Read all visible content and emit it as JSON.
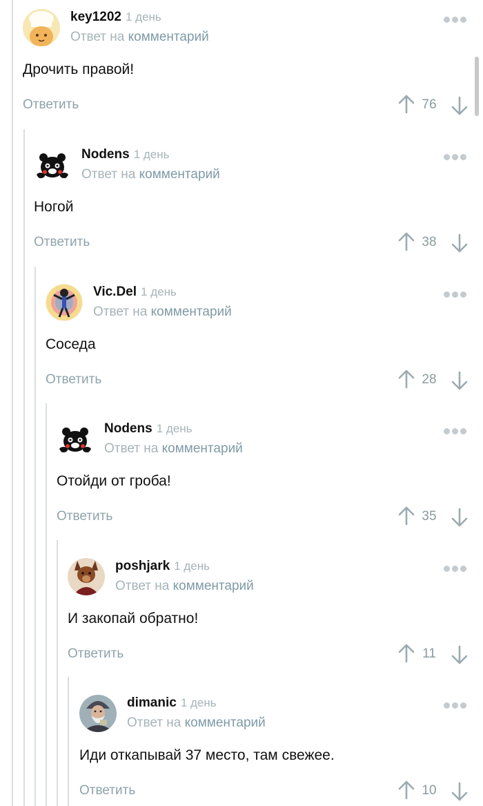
{
  "comments": [
    {
      "author": "key1202",
      "time": "1 день",
      "reply_prefix": "Ответ на",
      "reply_link": "комментарий",
      "text": "Дрочить правой!",
      "reply_label": "Ответить",
      "rating": "76",
      "avatar": "chef-cat-avatar"
    },
    {
      "author": "Nodens",
      "time": "1 день",
      "reply_prefix": "Ответ на",
      "reply_link": "комментарий",
      "text": "Ногой",
      "reply_label": "Ответить",
      "rating": "38",
      "avatar": "kumamon-bear-avatar"
    },
    {
      "author": "Vic.Del",
      "time": "1 день",
      "reply_prefix": "Ответ на",
      "reply_link": "комментарий",
      "text": "Соседа",
      "reply_label": "Ответить",
      "rating": "28",
      "avatar": "colorful-figure-avatar"
    },
    {
      "author": "Nodens",
      "time": "1 день",
      "reply_prefix": "Ответ на",
      "reply_link": "комментарий",
      "text": "Отойди от гроба!",
      "reply_label": "Ответить",
      "rating": "35",
      "avatar": "kumamon-bear-avatar"
    },
    {
      "author": "poshjark",
      "time": "1 день",
      "reply_prefix": "Ответ на",
      "reply_link": "комментарий",
      "text": "И закопай обратно!",
      "reply_label": "Ответить",
      "rating": "11",
      "avatar": "fox-character-avatar"
    },
    {
      "author": "dimanic",
      "time": "1 день",
      "reply_prefix": "Ответ на",
      "reply_link": "комментарий",
      "text": "Иди откапывай 37 место, там свежее.",
      "reply_label": "Ответить",
      "rating": "10",
      "avatar": "old-man-avatar"
    }
  ],
  "colors": {
    "thread_line": "#d9dee0",
    "reply_text": "#8fa3ab",
    "meta_text": "#a6b3b8",
    "link_text": "#7f9aa6"
  }
}
